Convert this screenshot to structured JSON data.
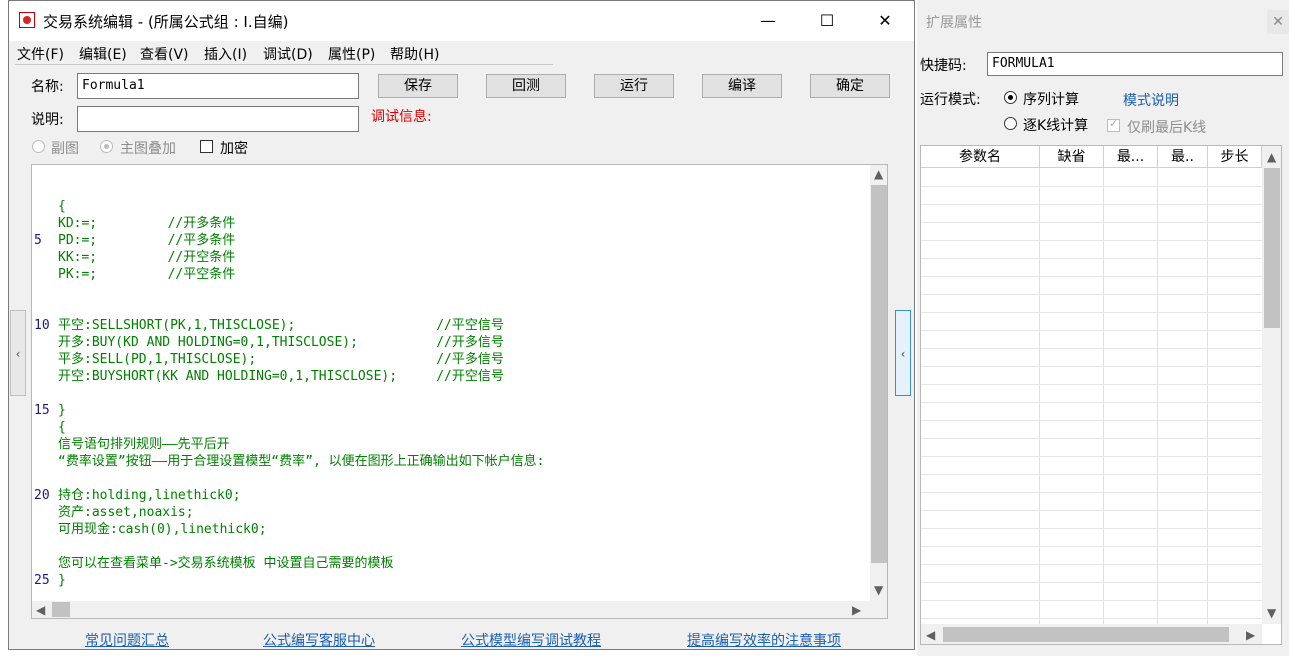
{
  "window": {
    "title": "交易系统编辑 - (所属公式组 : I.自编)",
    "min_glyph": "—",
    "max_glyph": "☐",
    "close_glyph": "✕"
  },
  "menu": [
    "文件(F)",
    "编辑(E)",
    "查看(V)",
    "插入(I)",
    "调试(D)",
    "属性(P)",
    "帮助(H)"
  ],
  "form": {
    "name_label": "名称:",
    "name_value": "Formula1",
    "desc_label": "说明:",
    "desc_value": "",
    "debug_label": "调试信息:",
    "radio_sub": "副图",
    "radio_main": "主图叠加",
    "encrypt_label": "加密"
  },
  "buttons": {
    "save": "保存",
    "backtest": "回测",
    "run": "运行",
    "compile": "编译",
    "ok": "确定"
  },
  "code": {
    "lines": [
      {
        "n": "",
        "t": "{"
      },
      {
        "n": "",
        "t": "KD:=;         //开多条件"
      },
      {
        "n": "5",
        "t": "PD:=;         //平多条件"
      },
      {
        "n": "",
        "t": "KK:=;         //开空条件"
      },
      {
        "n": "",
        "t": "PK:=;         //平空条件"
      },
      {
        "n": "",
        "t": ""
      },
      {
        "n": "",
        "t": ""
      },
      {
        "n": "10",
        "t": "平空:SELLSHORT(PK,1,THISCLOSE);                  //平空信号"
      },
      {
        "n": "",
        "t": "开多:BUY(KD AND HOLDING=0,1,THISCLOSE);          //开多信号"
      },
      {
        "n": "",
        "t": "平多:SELL(PD,1,THISCLOSE);                       //平多信号"
      },
      {
        "n": "",
        "t": "开空:BUYSHORT(KK AND HOLDING=0,1,THISCLOSE);     //开空信号"
      },
      {
        "n": "",
        "t": ""
      },
      {
        "n": "15",
        "t": "}"
      },
      {
        "n": "",
        "t": "{"
      },
      {
        "n": "",
        "t": "信号语句排列规则——先平后开"
      },
      {
        "n": "",
        "t": "“费率设置”按钮——用于合理设置模型“费率”, 以便在图形上正确输出如下帐户信息:"
      },
      {
        "n": "",
        "t": ""
      },
      {
        "n": "20",
        "t": "持仓:holding,linethick0;"
      },
      {
        "n": "",
        "t": "资产:asset,noaxis;"
      },
      {
        "n": "",
        "t": "可用现金:cash(0),linethick0;"
      },
      {
        "n": "",
        "t": ""
      },
      {
        "n": "",
        "t": "您可以在查看菜单->交易系统模板 中设置自己需要的模板"
      },
      {
        "n": "25",
        "t": "}"
      }
    ]
  },
  "links": [
    "常见问题汇总",
    "公式编写客服中心",
    "公式模型编写调试教程",
    "提高编写效率的注意事项"
  ],
  "panel": {
    "title": "扩展属性",
    "close_glyph": "✕",
    "shortcut_label": "快捷码:",
    "shortcut_value": "FORMULA1",
    "mode_label": "运行模式:",
    "mode_seq": "序列计算",
    "mode_k": "逐K线计算",
    "mode_help": "模式说明",
    "refresh_last": "仅刷最后K线",
    "columns": [
      "参数名",
      "缺省",
      "最...",
      "最..",
      "步长"
    ]
  },
  "colors": {
    "code_green": "#008000",
    "line_num": "#1a1a8a",
    "debug_red": "#e00000",
    "link_blue": "#1a5fb4"
  }
}
